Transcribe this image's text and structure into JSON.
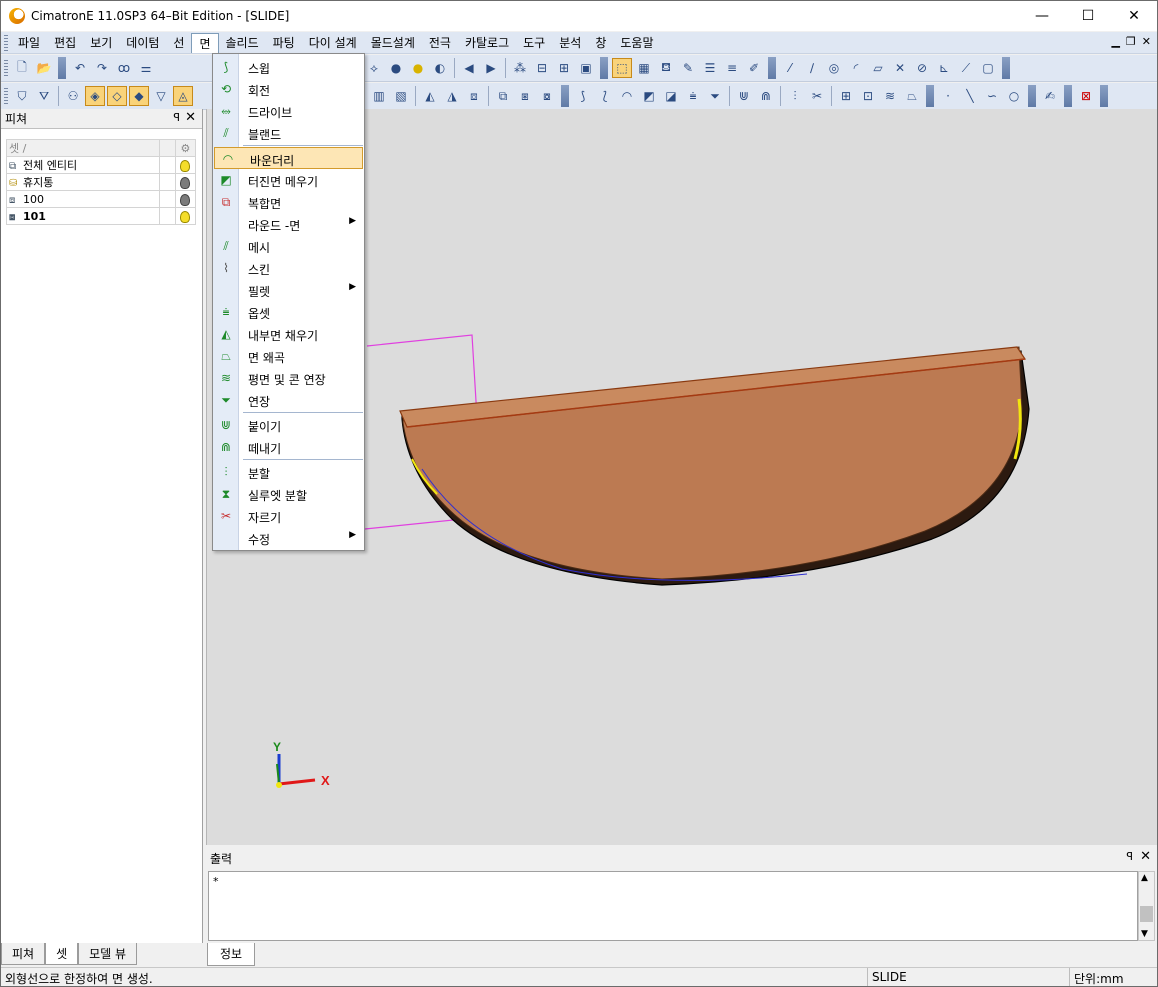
{
  "window": {
    "title": "CimatronE 11.0SP3 64–Bit Edition - [SLIDE]",
    "controls": [
      "—",
      "☐",
      "✕"
    ]
  },
  "menubar": {
    "items": [
      "파일",
      "편집",
      "보기",
      "데이텀",
      "선",
      "면",
      "솔리드",
      "파팅",
      "다이 설계",
      "몰드설계",
      "전극",
      "카탈로그",
      "도구",
      "분석",
      "창",
      "도움말"
    ],
    "active_index": 5
  },
  "left_panel": {
    "title": "피쳐",
    "pin": "↑",
    "close": "✕",
    "table": {
      "header": "셋 /",
      "rows": [
        {
          "name": "전체 엔티티",
          "bulb": "on",
          "bold": false
        },
        {
          "name": "휴지통",
          "bulb": "off",
          "bold": false
        },
        {
          "name": "100",
          "bulb": "off",
          "bold": false
        },
        {
          "name": "101",
          "bulb": "on",
          "bold": true
        }
      ]
    },
    "tabs": [
      "피쳐",
      "셋",
      "모델 뷰"
    ],
    "selected_tab": 1
  },
  "face_menu": {
    "items": [
      {
        "label": "스윕",
        "icon": "sweep-icon",
        "submenu": false
      },
      {
        "label": "회전",
        "icon": "revolve-icon",
        "submenu": false
      },
      {
        "label": "드라이브",
        "icon": "drive-icon",
        "submenu": false
      },
      {
        "label": "블랜드",
        "icon": "blend-icon",
        "submenu": false
      },
      {
        "label": "바운더리",
        "icon": "boundary-icon",
        "submenu": false,
        "highlighted": true
      },
      {
        "label": "터진면 메우기",
        "icon": "fill-hole-icon",
        "submenu": false
      },
      {
        "label": "복합면",
        "icon": "composite-icon",
        "submenu": false
      },
      {
        "label": "라운드 -면",
        "icon": "",
        "submenu": true
      },
      {
        "label": "메시",
        "icon": "mesh-icon",
        "submenu": false
      },
      {
        "label": "스킨",
        "icon": "skin-icon",
        "submenu": false
      },
      {
        "label": "필렛",
        "icon": "",
        "submenu": true
      },
      {
        "label": "옵셋",
        "icon": "offset-icon",
        "submenu": false
      },
      {
        "label": "내부면 채우기",
        "icon": "inner-fill-icon",
        "submenu": false
      },
      {
        "label": "면 왜곡",
        "icon": "warp-icon",
        "submenu": false
      },
      {
        "label": "평면 및 콘 연장",
        "icon": "plane-cone-extend-icon",
        "submenu": false
      },
      {
        "label": "연장",
        "icon": "extend-icon",
        "submenu": false
      },
      {
        "label": "붙이기",
        "icon": "attach-icon",
        "submenu": false
      },
      {
        "label": "떼내기",
        "icon": "detach-icon",
        "submenu": false
      },
      {
        "label": "분할",
        "icon": "split-icon",
        "submenu": false
      },
      {
        "label": "실루엣 분할",
        "icon": "silhouette-split-icon",
        "submenu": false
      },
      {
        "label": "자르기",
        "icon": "trim-icon",
        "submenu": false
      },
      {
        "label": "수정",
        "icon": "",
        "submenu": true
      }
    ]
  },
  "viewport": {
    "axis_x": "X",
    "axis_y": "Y",
    "model_color": "#c27f55",
    "background": "#dcdcdc"
  },
  "output_panel": {
    "title": "출력",
    "content": "*",
    "tab": "정보"
  },
  "statusbar": {
    "message": "외형선으로 한정하여 면 생성.",
    "document": "SLIDE",
    "units": "단위:mm"
  }
}
